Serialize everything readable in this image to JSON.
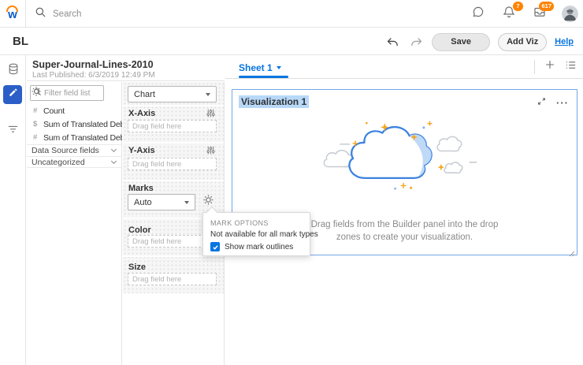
{
  "topbar": {
    "search_placeholder": "Search",
    "bell_badge": "7",
    "inbox_badge": "617"
  },
  "actionbar": {
    "title": "BL",
    "save_label": "Save",
    "add_viz_label": "Add Viz",
    "help_label": "Help"
  },
  "dataset": {
    "title": "Super-Journal-Lines-2010",
    "subtitle": "Last Published: 6/3/2019 12:49 PM"
  },
  "fields_panel": {
    "filter_placeholder": "Filter field list",
    "fields": [
      {
        "icon": "#",
        "label": "Count"
      },
      {
        "icon": "$",
        "label": "Sum of Translated Debits - S..."
      },
      {
        "icon": "#",
        "label": "Sum of Translated Debits - S..."
      }
    ],
    "sections": [
      {
        "label": "Data Source fields"
      },
      {
        "label": "Uncategorized"
      }
    ]
  },
  "builder": {
    "chart_type_value": "Chart",
    "x_axis_label": "X-Axis",
    "y_axis_label": "Y-Axis",
    "drop_placeholder": "Drag field here",
    "marks_label": "Marks",
    "marks_value": "Auto",
    "color_label": "Color",
    "size_label": "Size"
  },
  "mark_options_popup": {
    "title": "MARK OPTIONS",
    "note": "Not available for all mark types",
    "checkbox_label": "Show mark outlines",
    "checkbox_checked": true
  },
  "sheet_tabs": {
    "active_tab": "Sheet 1"
  },
  "canvas": {
    "viz_title": "Visualization 1",
    "empty_state_line1": "Drag fields from the Builder panel into the drop",
    "empty_state_line2": "zones to create your visualization."
  },
  "colors": {
    "accent_blue": "#0875e1",
    "logo_blue": "#0b5cc4",
    "logo_orange": "#ff8300",
    "badge_orange": "#ff8300",
    "pencil_tile_blue": "#2b5fc7",
    "viz_card_border": "#71a7e8",
    "selection_highlight": "#b8d8f7",
    "cloud_stroke": "#3b82e0",
    "cloud_shade": "#bfd9f6",
    "sparkle_orange": "#f6a51e"
  }
}
